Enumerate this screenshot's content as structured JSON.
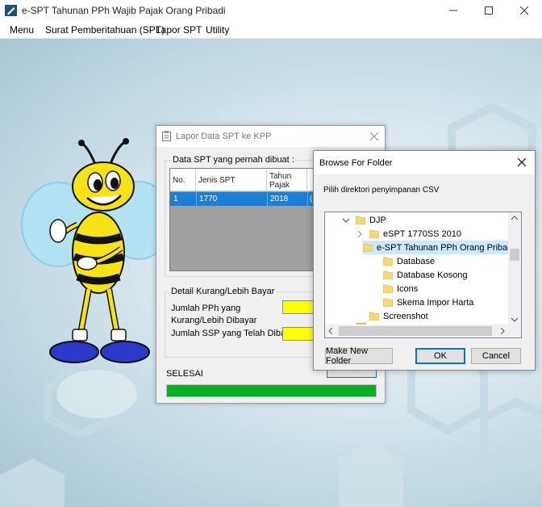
{
  "app": {
    "title": "e-SPT Tahunan PPh Wajib Pajak Orang Pribadi",
    "colors": {
      "accent": "#0078d7",
      "selection": "#1c7fd4",
      "progress": "#06b025",
      "highlight": "#ffff00"
    }
  },
  "menu": {
    "items": [
      "Menu",
      "Surat Pemberitahuan (SPT)",
      "Lapor SPT",
      "Utility"
    ]
  },
  "lapor_dialog": {
    "title": "Lapor Data SPT ke KPP",
    "group_spt_label": "Data SPT yang pernah dibuat :",
    "columns": [
      "No.",
      "Jenis SPT",
      "Tahun Pajak"
    ],
    "rows": [
      {
        "no": "1",
        "jenis": "1770",
        "tahun": "2018",
        "extra": "("
      }
    ],
    "group_detail_label": "Detail Kurang/Lebih Bayar",
    "pph_label": "Jumlah PPh yang Kurang/Lebih Dibayar",
    "ssp_label": "Jumlah SSP yang Telah Dibayar",
    "status": "SELESAI",
    "progress_percent": 100
  },
  "browse_dialog": {
    "title": "Browse For Folder",
    "instruction": "Pilih direktori penyimpanan CSV",
    "tree": [
      {
        "label": "DJP",
        "expander": "expanded"
      },
      {
        "label": "eSPT 1770SS 2010",
        "expander": "collapsed"
      },
      {
        "label": "e-SPT Tahunan PPh Orang Pribadi",
        "expander": "expanded",
        "selected": true
      },
      {
        "label": "Database"
      },
      {
        "label": "Database Kosong"
      },
      {
        "label": "Icons"
      },
      {
        "label": "Skema Impor Harta"
      },
      {
        "label": "Screenshot"
      }
    ],
    "buttons": {
      "new_folder": "Make New Folder",
      "ok": "OK",
      "cancel": "Cancel"
    }
  }
}
